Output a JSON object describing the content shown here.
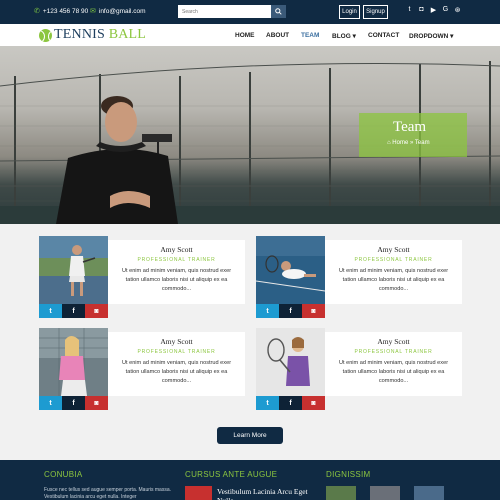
{
  "topbar": {
    "phone": "+123 456 78 90",
    "email": "info@gmail.com",
    "search_placeholder": "Search",
    "login_label": "Login",
    "signup_label": "Signup",
    "socials": [
      "twitter-icon",
      "instagram-icon",
      "youtube-icon",
      "google-icon",
      "dribbble-icon"
    ]
  },
  "nav": {
    "logo_prefix": "TENNIS",
    "logo_suffix": "BALL",
    "items": [
      "HOME",
      "ABOUT",
      "TEAM",
      "BLOG",
      "CONTACT",
      "DROPDOWN"
    ],
    "active": "TEAM"
  },
  "hero": {
    "title": "Team",
    "breadcrumb_home": "Home",
    "breadcrumb_sep": "»",
    "breadcrumb_current": "Team"
  },
  "team": [
    {
      "name": "Amy Scott",
      "role": "PROFESSIONAL TRAINER",
      "text": "Ut enim ad minim veniam, quis nostrud exer tation ullamco laboris nisi ut aliquip ex ea commodo..."
    },
    {
      "name": "Amy Scott",
      "role": "PROFESSIONAL TRAINER",
      "text": "Ut enim ad minim veniam, quis nostrud exer tation ullamco laboris nisi ut aliquip ex ea commodo..."
    },
    {
      "name": "Amy Scott",
      "role": "PROFESSIONAL TRAINER",
      "text": "Ut enim ad minim veniam, quis nostrud exer tation ullamco laboris nisi ut aliquip ex ea commodo..."
    },
    {
      "name": "Amy Scott",
      "role": "PROFESSIONAL TRAINER",
      "text": "Ut enim ad minim veniam, quis nostrud exer tation ullamco laboris nisi ut aliquip ex ea commodo..."
    }
  ],
  "learn_more": "Learn More",
  "footer": {
    "col1_title": "CONUBIA",
    "col1_text": "Fusce nec tellus sed augue semper porta. Mauris massa. Vestibulum lacinia arcu eget nulla. Integer",
    "col2_title": "CURSUS ANTE AUGUE",
    "col2_link": "Vestibulum Lacinia Arcu Eget Nulla",
    "col3_title": "DIGNISSIM"
  },
  "colors": {
    "accent": "#8cc63f",
    "navy": "#102a43",
    "twitter": "#1d9bd1",
    "instagram": "#c7302f"
  }
}
